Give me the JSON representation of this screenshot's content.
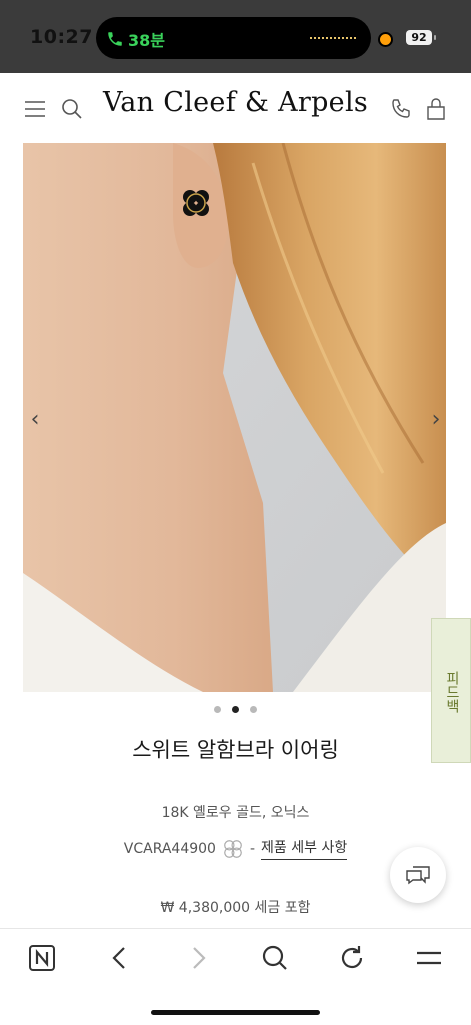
{
  "status_bar": {
    "time": "10:27",
    "call_duration": "38분",
    "battery": "92"
  },
  "header": {
    "logo": "Van Cleef & Arpels",
    "icons": [
      "menu-icon",
      "search-icon",
      "phone-icon",
      "shopping-bag-icon"
    ]
  },
  "gallery": {
    "prev": "‹",
    "next": "›",
    "dot_count": 3,
    "active_index": 1
  },
  "feedback": {
    "label": "피드백"
  },
  "product": {
    "title": "스위트 알함브라 이어링",
    "material": "18K 옐로우 골드, 오닉스",
    "reference": "VCARA44900",
    "separator": "-",
    "details_link": "제품 세부 사항",
    "price": "₩ 4,380,000 세금 포함"
  },
  "toolbar": {
    "icons": [
      "naver-home-icon",
      "back-icon",
      "forward-icon",
      "search-icon",
      "refresh-icon",
      "menu-icon"
    ]
  },
  "colors": {
    "status_bar_bg": "#3b3b3b",
    "call_green": "#3ad25b",
    "feedback_bg": "#e9efd9",
    "feedback_text": "#6a7a2f"
  }
}
